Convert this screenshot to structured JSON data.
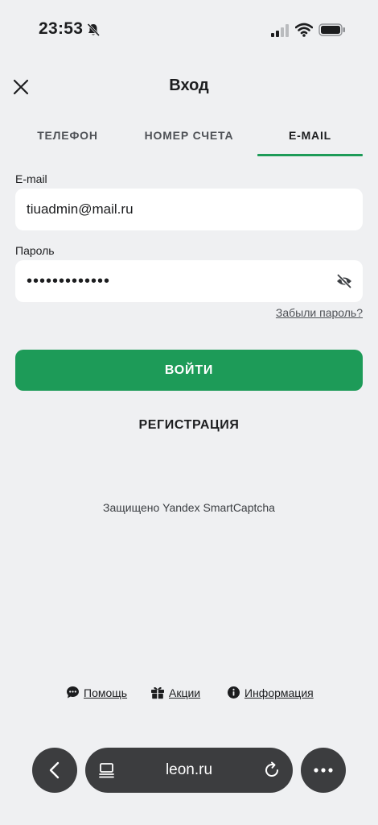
{
  "status_bar": {
    "time": "23:53",
    "icons": [
      "bell-slash-icon",
      "signal-icon",
      "wifi-icon",
      "battery-icon"
    ]
  },
  "header": {
    "title": "Вход",
    "close_icon": "close-icon"
  },
  "tabs": [
    {
      "label": "ТЕЛЕФОН",
      "active": false
    },
    {
      "label": "НОМЕР СЧЕТА",
      "active": false
    },
    {
      "label": "E-MAIL",
      "active": true
    }
  ],
  "form": {
    "email_label": "E-mail",
    "email_value": "tiuadmin@mail.ru",
    "password_label": "Пароль",
    "password_value": "•••••••••••••",
    "forgot_link": "Забыли пароль?",
    "login_button": "ВОЙТИ",
    "register_button": "РЕГИСТРАЦИЯ"
  },
  "captcha_note": "Защищено Yandex SmartCaptcha",
  "footer": {
    "help": "Помощь",
    "promotions": "Акции",
    "information": "Информация"
  },
  "browser": {
    "url": "leon.ru"
  },
  "colors": {
    "accent": "#1d9b58",
    "background": "#eff0f2",
    "browser_controls": "#3c3d3f"
  }
}
